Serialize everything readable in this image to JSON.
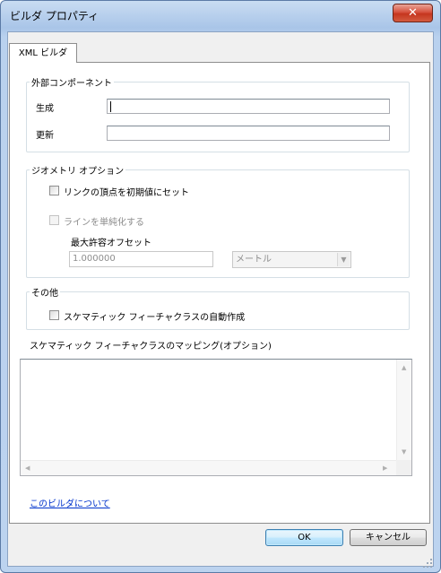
{
  "window": {
    "title": "ビルダ プロパティ",
    "close_glyph": "✕"
  },
  "tab": {
    "label": "XML ビルダ"
  },
  "external_component": {
    "legend": "外部コンポーネント",
    "create_label": "生成",
    "create_value": "",
    "update_label": "更新",
    "update_value": ""
  },
  "geometry_options": {
    "legend": "ジオメトリ オプション",
    "snap_vertices_label": "リンクの頂点を初期値にセット",
    "snap_vertices_checked": false,
    "simplify_lines_label": "ラインを単純化する",
    "simplify_lines_checked": false,
    "max_offset_label": "最大許容オフセット",
    "max_offset_value": "1.000000",
    "unit_value": "メートル"
  },
  "other": {
    "legend": "その他",
    "auto_create_label": "スケマティック フィーチャクラスの自動作成",
    "auto_create_checked": false
  },
  "mapping": {
    "label": "スケマティック フィーチャクラスのマッピング(オプション)",
    "items": []
  },
  "about_link": "このビルダについて",
  "buttons": {
    "ok": "OK",
    "cancel": "キャンセル"
  },
  "colors": {
    "close_button": "#c5361f",
    "link": "#0033cc",
    "default_button_border": "#3c7fb1"
  }
}
